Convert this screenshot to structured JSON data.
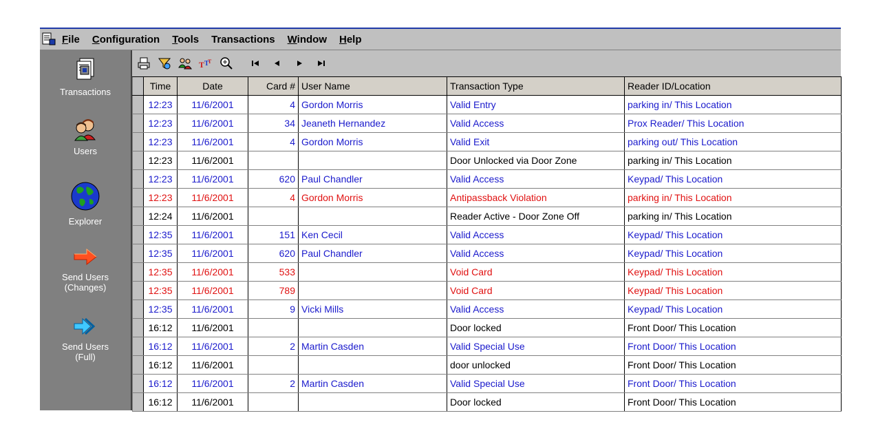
{
  "menu": {
    "items": [
      {
        "first": "F",
        "rest": "ile",
        "underline": true
      },
      {
        "first": "C",
        "rest": "onfiguration",
        "underline": true
      },
      {
        "first": "T",
        "rest": "ools",
        "underline": true
      },
      {
        "first": "",
        "rest": "Transactions",
        "underline": false
      },
      {
        "first": "W",
        "rest": "indow",
        "underline": true
      },
      {
        "first": "H",
        "rest": "elp",
        "underline": true
      }
    ]
  },
  "sidebar": {
    "items": [
      {
        "line1": "Transactions",
        "line2": "",
        "icon": "transactions-icon"
      },
      {
        "line1": "Users",
        "line2": "",
        "icon": "users-icon"
      },
      {
        "line1": "Explorer",
        "line2": "",
        "icon": "globe-icon"
      },
      {
        "line1": "Send Users",
        "line2": "(Changes)",
        "icon": "arrow-right-icon"
      },
      {
        "line1": "Send Users",
        "line2": "(Full)",
        "icon": "double-arrow-icon"
      }
    ]
  },
  "toolbar": {
    "icons": [
      "print-icon",
      "filter-icon",
      "users-tool-icon",
      "font-icon",
      "zoom-in-icon"
    ],
    "nav": [
      "first-record-icon",
      "previous-record-icon",
      "next-record-icon",
      "last-record-icon"
    ]
  },
  "colors": {
    "blue": "#1a1acc",
    "red": "#e01010",
    "black": "#000000"
  },
  "table": {
    "headers": {
      "time": "Time",
      "date": "Date",
      "card": "Card #",
      "user": "User Name",
      "type": "Transaction Type",
      "reader": "Reader ID/Location"
    },
    "rows": [
      {
        "time": "12:23",
        "date": "11/6/2001",
        "card": "4",
        "user": "Gordon Morris",
        "type": "Valid Entry",
        "reader": "parking in/ This Location",
        "color": "blue"
      },
      {
        "time": "12:23",
        "date": "11/6/2001",
        "card": "34",
        "user": "Jeaneth Hernandez",
        "type": "Valid Access",
        "reader": "Prox Reader/ This Location",
        "color": "blue"
      },
      {
        "time": "12:23",
        "date": "11/6/2001",
        "card": "4",
        "user": "Gordon Morris",
        "type": "Valid Exit",
        "reader": "parking out/ This Location",
        "color": "blue"
      },
      {
        "time": "12:23",
        "date": "11/6/2001",
        "card": "",
        "user": "",
        "type": "Door Unlocked via Door Zone",
        "reader": "parking in/ This Location",
        "color": "black"
      },
      {
        "time": "12:23",
        "date": "11/6/2001",
        "card": "620",
        "user": "Paul Chandler",
        "type": "Valid Access",
        "reader": "Keypad/ This Location",
        "color": "blue"
      },
      {
        "time": "12:23",
        "date": "11/6/2001",
        "card": "4",
        "user": "Gordon Morris",
        "type": "Antipassback Violation",
        "reader": "parking in/ This Location",
        "color": "red"
      },
      {
        "time": "12:24",
        "date": "11/6/2001",
        "card": "",
        "user": "",
        "type": "Reader Active - Door Zone Off",
        "reader": "parking in/ This Location",
        "color": "black"
      },
      {
        "time": "12:35",
        "date": "11/6/2001",
        "card": "151",
        "user": "Ken Cecil",
        "type": "Valid Access",
        "reader": "Keypad/ This Location",
        "color": "blue"
      },
      {
        "time": "12:35",
        "date": "11/6/2001",
        "card": "620",
        "user": "Paul Chandler",
        "type": "Valid Access",
        "reader": "Keypad/ This Location",
        "color": "blue"
      },
      {
        "time": "12:35",
        "date": "11/6/2001",
        "card": "533",
        "user": "",
        "type": "Void Card",
        "reader": "Keypad/ This Location",
        "color": "red"
      },
      {
        "time": "12:35",
        "date": "11/6/2001",
        "card": "789",
        "user": "",
        "type": "Void Card",
        "reader": "Keypad/ This Location",
        "color": "red"
      },
      {
        "time": "12:35",
        "date": "11/6/2001",
        "card": "9",
        "user": "Vicki Mills",
        "type": "Valid Access",
        "reader": "Keypad/ This Location",
        "color": "blue"
      },
      {
        "time": "16:12",
        "date": "11/6/2001",
        "card": "",
        "user": "",
        "type": "Door locked",
        "reader": "Front Door/ This Location",
        "color": "black"
      },
      {
        "time": "16:12",
        "date": "11/6/2001",
        "card": "2",
        "user": "Martin Casden",
        "type": "Valid Special Use",
        "reader": "Front Door/ This Location",
        "color": "blue"
      },
      {
        "time": "16:12",
        "date": "11/6/2001",
        "card": "",
        "user": "",
        "type": "door unlocked",
        "reader": "Front Door/ This Location",
        "color": "black"
      },
      {
        "time": "16:12",
        "date": "11/6/2001",
        "card": "2",
        "user": "Martin Casden",
        "type": "Valid Special Use",
        "reader": "Front Door/ This Location",
        "color": "blue"
      },
      {
        "time": "16:12",
        "date": "11/6/2001",
        "card": "",
        "user": "",
        "type": "Door locked",
        "reader": "Front Door/ This Location",
        "color": "black"
      }
    ]
  }
}
